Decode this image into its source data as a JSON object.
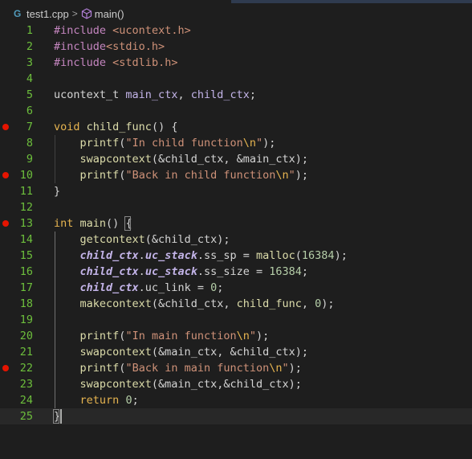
{
  "breadcrumb": {
    "file_icon": "G",
    "file": "test1.cpp",
    "separator": ">",
    "symbol": "main()"
  },
  "colors": {
    "default": "#d4d4d4",
    "keyword": "#c586c0",
    "type": "#e6b450",
    "func": "#dcdcaa",
    "string": "#ce9178",
    "number": "#b5cea8",
    "var": "#c3b4e8",
    "operator": "#d4d4d4"
  },
  "lines": [
    {
      "n": "1",
      "bp": false,
      "tokens": [
        [
          "#include",
          "kw"
        ],
        [
          " ",
          "d"
        ],
        [
          "<ucontext.h>",
          "str"
        ]
      ]
    },
    {
      "n": "2",
      "bp": false,
      "tokens": [
        [
          "#include",
          "kw"
        ],
        [
          "<stdio.h>",
          "str"
        ]
      ]
    },
    {
      "n": "3",
      "bp": false,
      "tokens": [
        [
          "#include",
          "kw"
        ],
        [
          " ",
          "d"
        ],
        [
          "<stdlib.h>",
          "str"
        ]
      ]
    },
    {
      "n": "4",
      "bp": false,
      "tokens": []
    },
    {
      "n": "5",
      "bp": false,
      "tokens": [
        [
          "ucontext_t",
          "d"
        ],
        [
          " ",
          "d"
        ],
        [
          "main_ctx",
          "var"
        ],
        [
          ", ",
          "d"
        ],
        [
          "child_ctx",
          "var"
        ],
        [
          ";",
          "d"
        ]
      ]
    },
    {
      "n": "6",
      "bp": false,
      "tokens": []
    },
    {
      "n": "7",
      "bp": true,
      "tokens": [
        [
          "void",
          "type"
        ],
        [
          " ",
          "d"
        ],
        [
          "child_func",
          "fn"
        ],
        [
          "() {",
          "d"
        ]
      ]
    },
    {
      "n": "8",
      "bp": false,
      "tokens": [
        [
          "    ",
          "d"
        ],
        [
          "printf",
          "fn"
        ],
        [
          "(",
          "d"
        ],
        [
          "\"In child function",
          "str"
        ],
        [
          "\\n",
          "esc"
        ],
        [
          "\"",
          "str"
        ],
        [
          ");",
          "d"
        ]
      ]
    },
    {
      "n": "9",
      "bp": false,
      "tokens": [
        [
          "    ",
          "d"
        ],
        [
          "swapcontext",
          "fn"
        ],
        [
          "(&child_ctx, &main_ctx);",
          "d"
        ]
      ]
    },
    {
      "n": "10",
      "bp": true,
      "tokens": [
        [
          "    ",
          "d"
        ],
        [
          "printf",
          "fn"
        ],
        [
          "(",
          "d"
        ],
        [
          "\"Back in child function",
          "str"
        ],
        [
          "\\n",
          "esc"
        ],
        [
          "\"",
          "str"
        ],
        [
          ");",
          "d"
        ]
      ]
    },
    {
      "n": "11",
      "bp": false,
      "tokens": [
        [
          "}",
          "d"
        ]
      ]
    },
    {
      "n": "12",
      "bp": false,
      "tokens": []
    },
    {
      "n": "13",
      "bp": true,
      "tokens": [
        [
          "int",
          "type"
        ],
        [
          " ",
          "d"
        ],
        [
          "main",
          "fn"
        ],
        [
          "() ",
          "d"
        ],
        [
          "{",
          "d"
        ]
      ]
    },
    {
      "n": "14",
      "bp": false,
      "tokens": [
        [
          "    ",
          "d"
        ],
        [
          "getcontext",
          "fn"
        ],
        [
          "(&child_ctx);",
          "d"
        ]
      ]
    },
    {
      "n": "15",
      "bp": false,
      "tokens": [
        [
          "    ",
          "d"
        ],
        [
          "child_ctx",
          "ivar"
        ],
        [
          ".",
          "d"
        ],
        [
          "uc_stack",
          "ivar"
        ],
        [
          ".ss_sp = ",
          "d"
        ],
        [
          "malloc",
          "fn"
        ],
        [
          "(",
          "d"
        ],
        [
          "16384",
          "num"
        ],
        [
          ");",
          "d"
        ]
      ]
    },
    {
      "n": "16",
      "bp": false,
      "tokens": [
        [
          "    ",
          "d"
        ],
        [
          "child_ctx",
          "ivar"
        ],
        [
          ".",
          "d"
        ],
        [
          "uc_stack",
          "ivar"
        ],
        [
          ".ss_size = ",
          "d"
        ],
        [
          "16384",
          "num"
        ],
        [
          ";",
          "d"
        ]
      ]
    },
    {
      "n": "17",
      "bp": false,
      "tokens": [
        [
          "    ",
          "d"
        ],
        [
          "child_ctx",
          "ivar"
        ],
        [
          ".uc_link = ",
          "d"
        ],
        [
          "0",
          "num"
        ],
        [
          ";",
          "d"
        ]
      ]
    },
    {
      "n": "18",
      "bp": false,
      "tokens": [
        [
          "    ",
          "d"
        ],
        [
          "makecontext",
          "fn"
        ],
        [
          "(&child_ctx, ",
          "d"
        ],
        [
          "child_func",
          "fn"
        ],
        [
          ", ",
          "d"
        ],
        [
          "0",
          "num"
        ],
        [
          ");",
          "d"
        ]
      ]
    },
    {
      "n": "19",
      "bp": false,
      "tokens": []
    },
    {
      "n": "20",
      "bp": false,
      "tokens": [
        [
          "    ",
          "d"
        ],
        [
          "printf",
          "fn"
        ],
        [
          "(",
          "d"
        ],
        [
          "\"In main function",
          "str"
        ],
        [
          "\\n",
          "esc"
        ],
        [
          "\"",
          "str"
        ],
        [
          ");",
          "d"
        ]
      ]
    },
    {
      "n": "21",
      "bp": false,
      "tokens": [
        [
          "    ",
          "d"
        ],
        [
          "swapcontext",
          "fn"
        ],
        [
          "(&main_ctx, &child_ctx);",
          "d"
        ]
      ]
    },
    {
      "n": "22",
      "bp": true,
      "tokens": [
        [
          "    ",
          "d"
        ],
        [
          "printf",
          "fn"
        ],
        [
          "(",
          "d"
        ],
        [
          "\"Back in main function",
          "str"
        ],
        [
          "\\n",
          "esc"
        ],
        [
          "\"",
          "str"
        ],
        [
          ");",
          "d"
        ]
      ]
    },
    {
      "n": "23",
      "bp": false,
      "tokens": [
        [
          "    ",
          "d"
        ],
        [
          "swapcontext",
          "fn"
        ],
        [
          "(&main_ctx,&child_ctx);",
          "d"
        ]
      ]
    },
    {
      "n": "24",
      "bp": false,
      "tokens": [
        [
          "    ",
          "d"
        ],
        [
          "return",
          "type"
        ],
        [
          " ",
          "d"
        ],
        [
          "0",
          "num"
        ],
        [
          ";",
          "d"
        ]
      ]
    },
    {
      "n": "25",
      "bp": false,
      "current": true,
      "tokens": [
        [
          "}",
          "d"
        ]
      ]
    }
  ]
}
